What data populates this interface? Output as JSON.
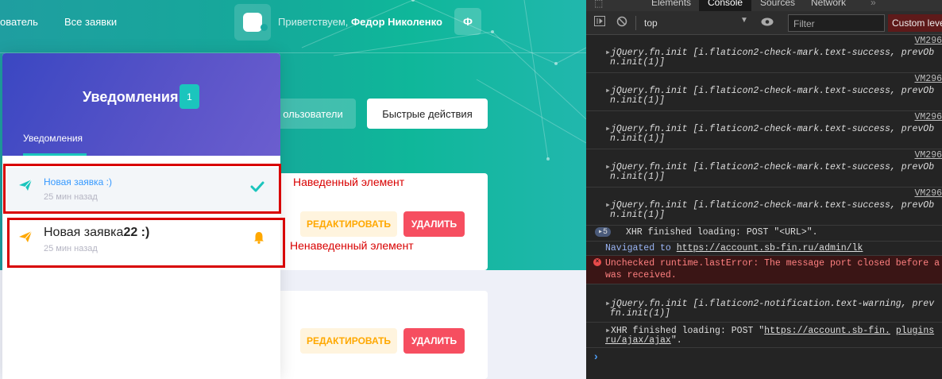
{
  "header": {
    "nav": [
      "ователь",
      "Все заявки"
    ],
    "greeting_prefix": "Приветствуем,",
    "user_name": "Федор Николенко",
    "avatar_letter": "Ф",
    "buttons": {
      "users": "ользователи",
      "quick_actions": "Быстрые действия"
    }
  },
  "cards": [
    {
      "edit": "РЕДАКТИРОВАТЬ",
      "delete": "УДАЛИТЬ"
    },
    {
      "edit": "РЕДАКТИРОВАТЬ",
      "delete": "УДАЛИТЬ"
    }
  ],
  "notifications": {
    "title": "Уведомления",
    "badge": "1",
    "tab": "Уведомления",
    "items": [
      {
        "title": "Новая заявка :)",
        "time": "25 мин назад",
        "status_icon": "check-icon",
        "type_icon": "paper-plane-icon"
      },
      {
        "title": "Новая заявка",
        "title_bold": "22 :)",
        "time": "25 мин назад",
        "status_icon": "bell-icon",
        "type_icon": "paper-plane-icon"
      }
    ]
  },
  "annotations": {
    "hovered": "Наведенный элемент",
    "not_hovered": "Ненаведенный элемент"
  },
  "devtools": {
    "tabs": [
      "Elements",
      "Console",
      "Sources",
      "Network"
    ],
    "context": "top",
    "filter_placeholder": "Filter",
    "levels": "Custom levels",
    "logs": [
      {
        "source": "VM296",
        "line1": "jQuery.fn.init [i.flaticon2-check-mark.text-success, prevOb",
        "line2": "n.init(1)]"
      },
      {
        "source": "VM296",
        "line1": "jQuery.fn.init [i.flaticon2-check-mark.text-success, prevOb",
        "line2": "n.init(1)]"
      },
      {
        "source": "VM296",
        "line1": "jQuery.fn.init [i.flaticon2-check-mark.text-success, prevOb",
        "line2": "n.init(1)]"
      },
      {
        "source": "VM296",
        "line1": "jQuery.fn.init [i.flaticon2-check-mark.text-success, prevOb",
        "line2": "n.init(1)]"
      },
      {
        "source": "VM296",
        "line1": "jQuery.fn.init [i.flaticon2-check-mark.text-success, prevOb",
        "line2": "n.init(1)]"
      }
    ],
    "xhr1_count": "5",
    "xhr1": "XHR finished loading: POST \"<URL>\".",
    "navigated_prefix": "Navigated to",
    "navigated_url": "https://account.sb-fin.ru/admin/lk",
    "error_line1": "Unchecked runtime.lastError: The message port closed before a",
    "error_line2": "was received.",
    "log6_line1": "jQuery.fn.init [i.flaticon2-notification.text-warning, prev",
    "log6_line2": "fn.init(1)]",
    "xhr2_prefix": "XHR finished loading: POST \"",
    "xhr2_url": "https://account.sb-fin.",
    "xhr2_tail": "plugins",
    "xhr2_line2": "ru/ajax/ajax",
    "xhr2_end": "\".",
    "prompt": "›"
  }
}
